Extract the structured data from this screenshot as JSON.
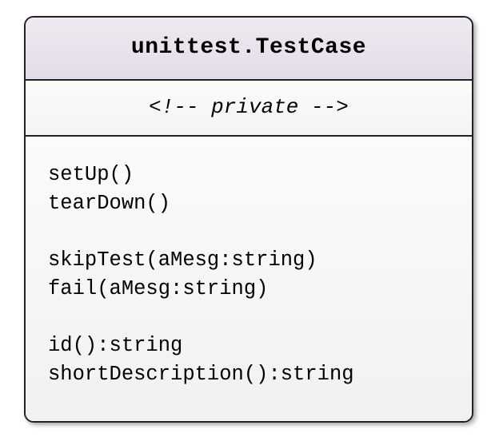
{
  "class": {
    "name": "unittest.TestCase",
    "attributes_label": "<!-- private -->",
    "operations": [
      "setUp()",
      "tearDown()",
      "",
      "skipTest(aMesg:string)",
      "fail(aMesg:string)",
      "",
      "id():string",
      "shortDescription():string"
    ]
  }
}
